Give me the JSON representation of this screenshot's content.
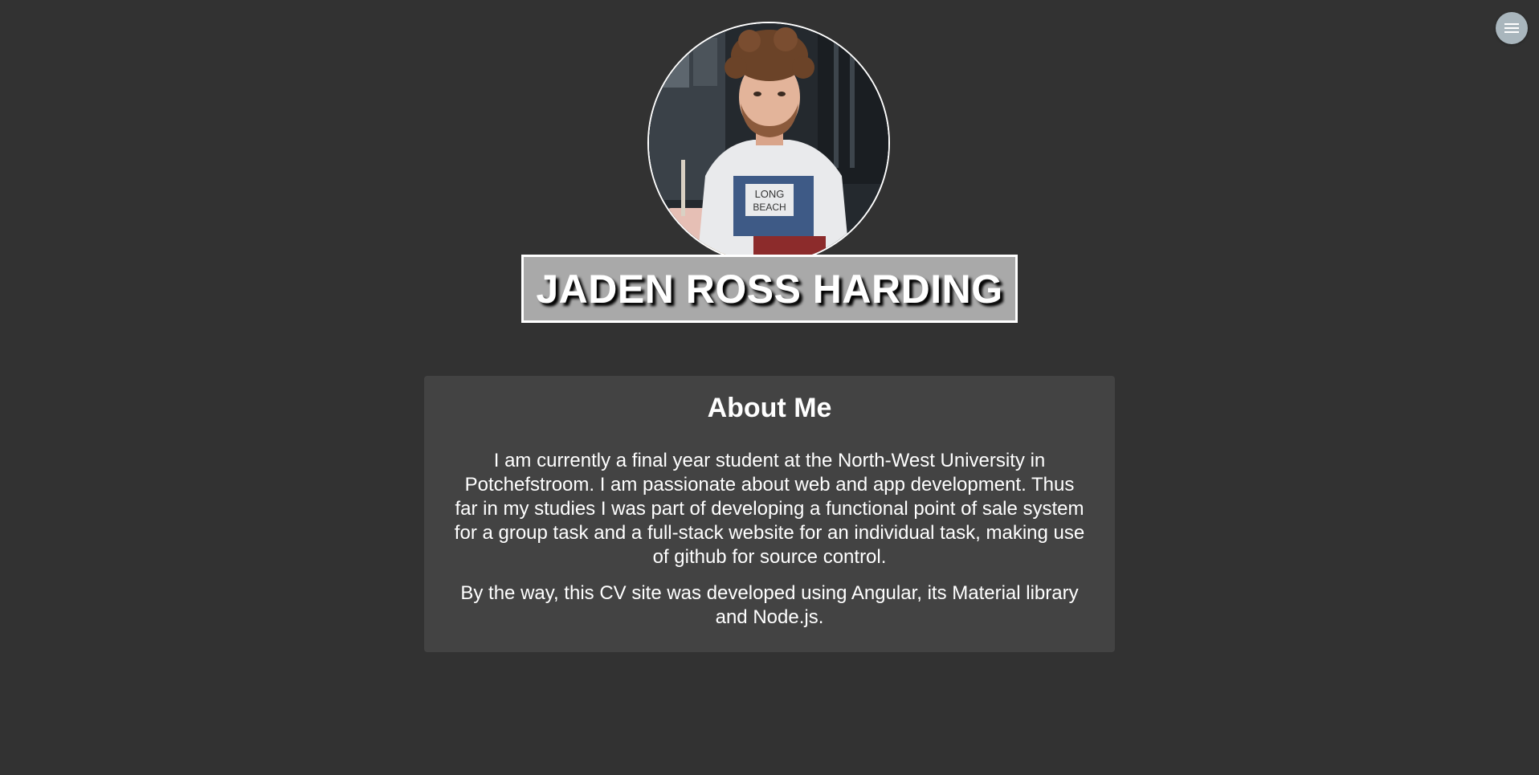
{
  "header": {
    "menu_icon": "hamburger-menu-icon",
    "menu_button_color": "#a9b6bd",
    "avatar_icon": "profile-photo"
  },
  "profile": {
    "name": "JADEN ROSS HARDING",
    "shirt_text_line1": "LONG",
    "shirt_text_line2": "BEACH"
  },
  "about": {
    "title": "About Me",
    "paragraphs": [
      "I am currently a final year student at the North-West University in Potchefstroom. I am passionate about web and app development. Thus far in my studies I was part of developing a functional point of sale system for a group task and a full-stack website for an individual task, making use of github for source control.",
      "By the way, this CV site was developed using Angular, its Material library and Node.js."
    ]
  },
  "colors": {
    "background": "#323232",
    "card": "#434343",
    "banner": "#a9a9a9",
    "text": "#ffffff"
  }
}
